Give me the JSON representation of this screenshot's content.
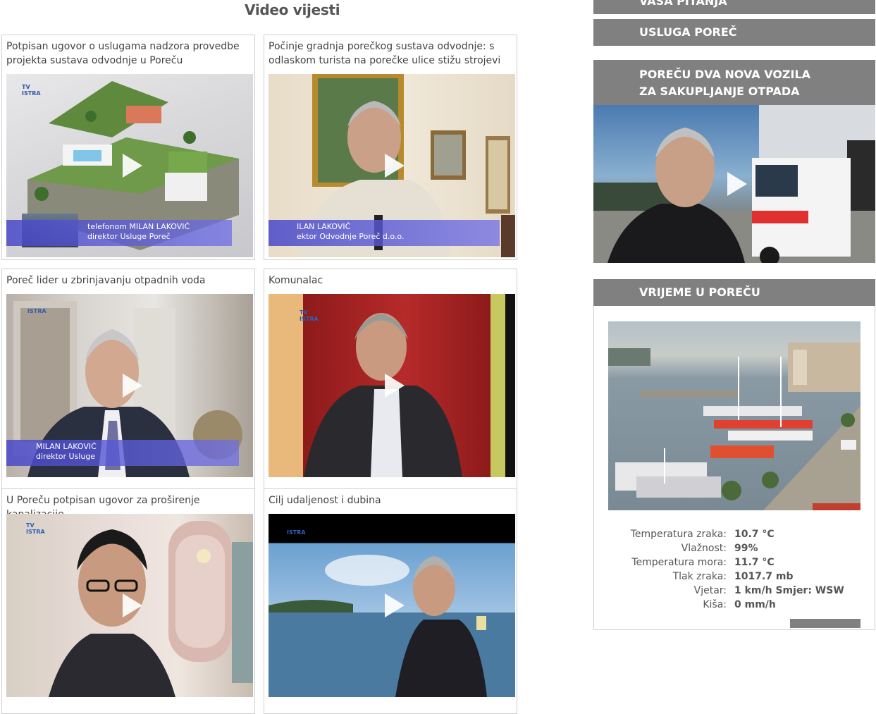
{
  "header": {
    "title": "Video vijesti"
  },
  "videos": [
    {
      "title": "Potpisan ugovor o uslugama nadzora provedbe projekta sustava odvodnje u Poreču",
      "caption_line1": "telefonom MILAN LAKOVIĆ",
      "caption_line2": "direktor Usluge Poreč",
      "logo": "TV ISTRA"
    },
    {
      "title": "Počinje gradnja porečkog sustava odvodnje: s odlaskom turista na porečke ulice stižu strojevi",
      "caption_line1": "ILAN LAKOVIĆ",
      "caption_line2": "ektor Odvodnje Poreč d.o.o.",
      "logo": ""
    },
    {
      "title": "Poreč lider u zbrinjavanju otpadnih voda",
      "caption_line1": "MILAN LAKOVIĆ",
      "caption_line2": "direktor Usluge",
      "logo": "ISTRA"
    },
    {
      "title": "Komunalac",
      "caption_line1": "",
      "caption_line2": "",
      "logo": "TV ISTRA"
    },
    {
      "title": "U Poreču potpisan ugovor za proširenje kanalizacije",
      "caption_line1": "",
      "caption_line2": "",
      "logo": "TV ISTRA"
    },
    {
      "title": "Cilj udaljenost i dubina",
      "caption_line1": "",
      "caption_line2": "",
      "logo": "ISTRA"
    }
  ],
  "sidebar": {
    "btn_pitanja": "VAŠA PITANJA",
    "btn_usluga": "USLUGA POREČ",
    "news_title": "POREČU DVA NOVA VOZILA ZA SAKUPLJANJE OTPADA",
    "weather_title": "VRIJEME U POREČU",
    "weather": [
      {
        "label": "Temperatura zraka:",
        "value": "10.7 °C"
      },
      {
        "label": "Vlažnost:",
        "value": "99%"
      },
      {
        "label": "Temperatura mora:",
        "value": "11.7 °C"
      },
      {
        "label": "Tlak zraka:",
        "value": "1017.7 mb"
      },
      {
        "label": "Vjetar:",
        "value": "1 km/h Smjer: WSW"
      },
      {
        "label": "Kiša:",
        "value": "0 mm/h"
      }
    ]
  },
  "colors": {
    "sidebar_button": "#808080",
    "caption_band": "#5050d0",
    "border": "#cfcfcf"
  }
}
